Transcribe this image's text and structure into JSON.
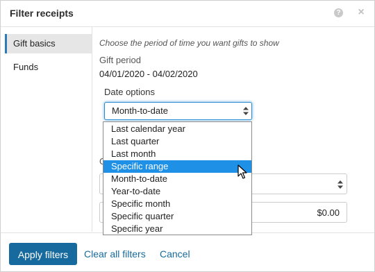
{
  "dialog": {
    "title": "Filter receipts",
    "help_icon": "question-circle-icon",
    "help_glyph": "?",
    "close_icon": "close-icon",
    "close_glyph": "×"
  },
  "sidebar": {
    "items": [
      {
        "label": "Gift basics",
        "active": true
      },
      {
        "label": "Funds",
        "active": false
      }
    ]
  },
  "main": {
    "subtitle": "Choose the period of time you want gifts to show",
    "gift_period_label": "Gift period",
    "gift_period_value": "04/01/2020 - 04/02/2020",
    "date_options_label": "Date options",
    "date_options_selected": "Month-to-date",
    "partial_label": "G",
    "amount_value": "$0.00"
  },
  "dropdown": {
    "options": [
      "Last calendar year",
      "Last quarter",
      "Last month",
      "Specific range",
      "Month-to-date",
      "Year-to-date",
      "Specific month",
      "Specific quarter",
      "Specific year"
    ],
    "highlighted": "Specific range"
  },
  "footer": {
    "apply_label": "Apply filters",
    "clear_label": "Clear all filters",
    "cancel_label": "Cancel"
  },
  "colors": {
    "accent": "#176a9e",
    "highlight": "#1e90e6",
    "focus_border": "#2b8bd0"
  }
}
